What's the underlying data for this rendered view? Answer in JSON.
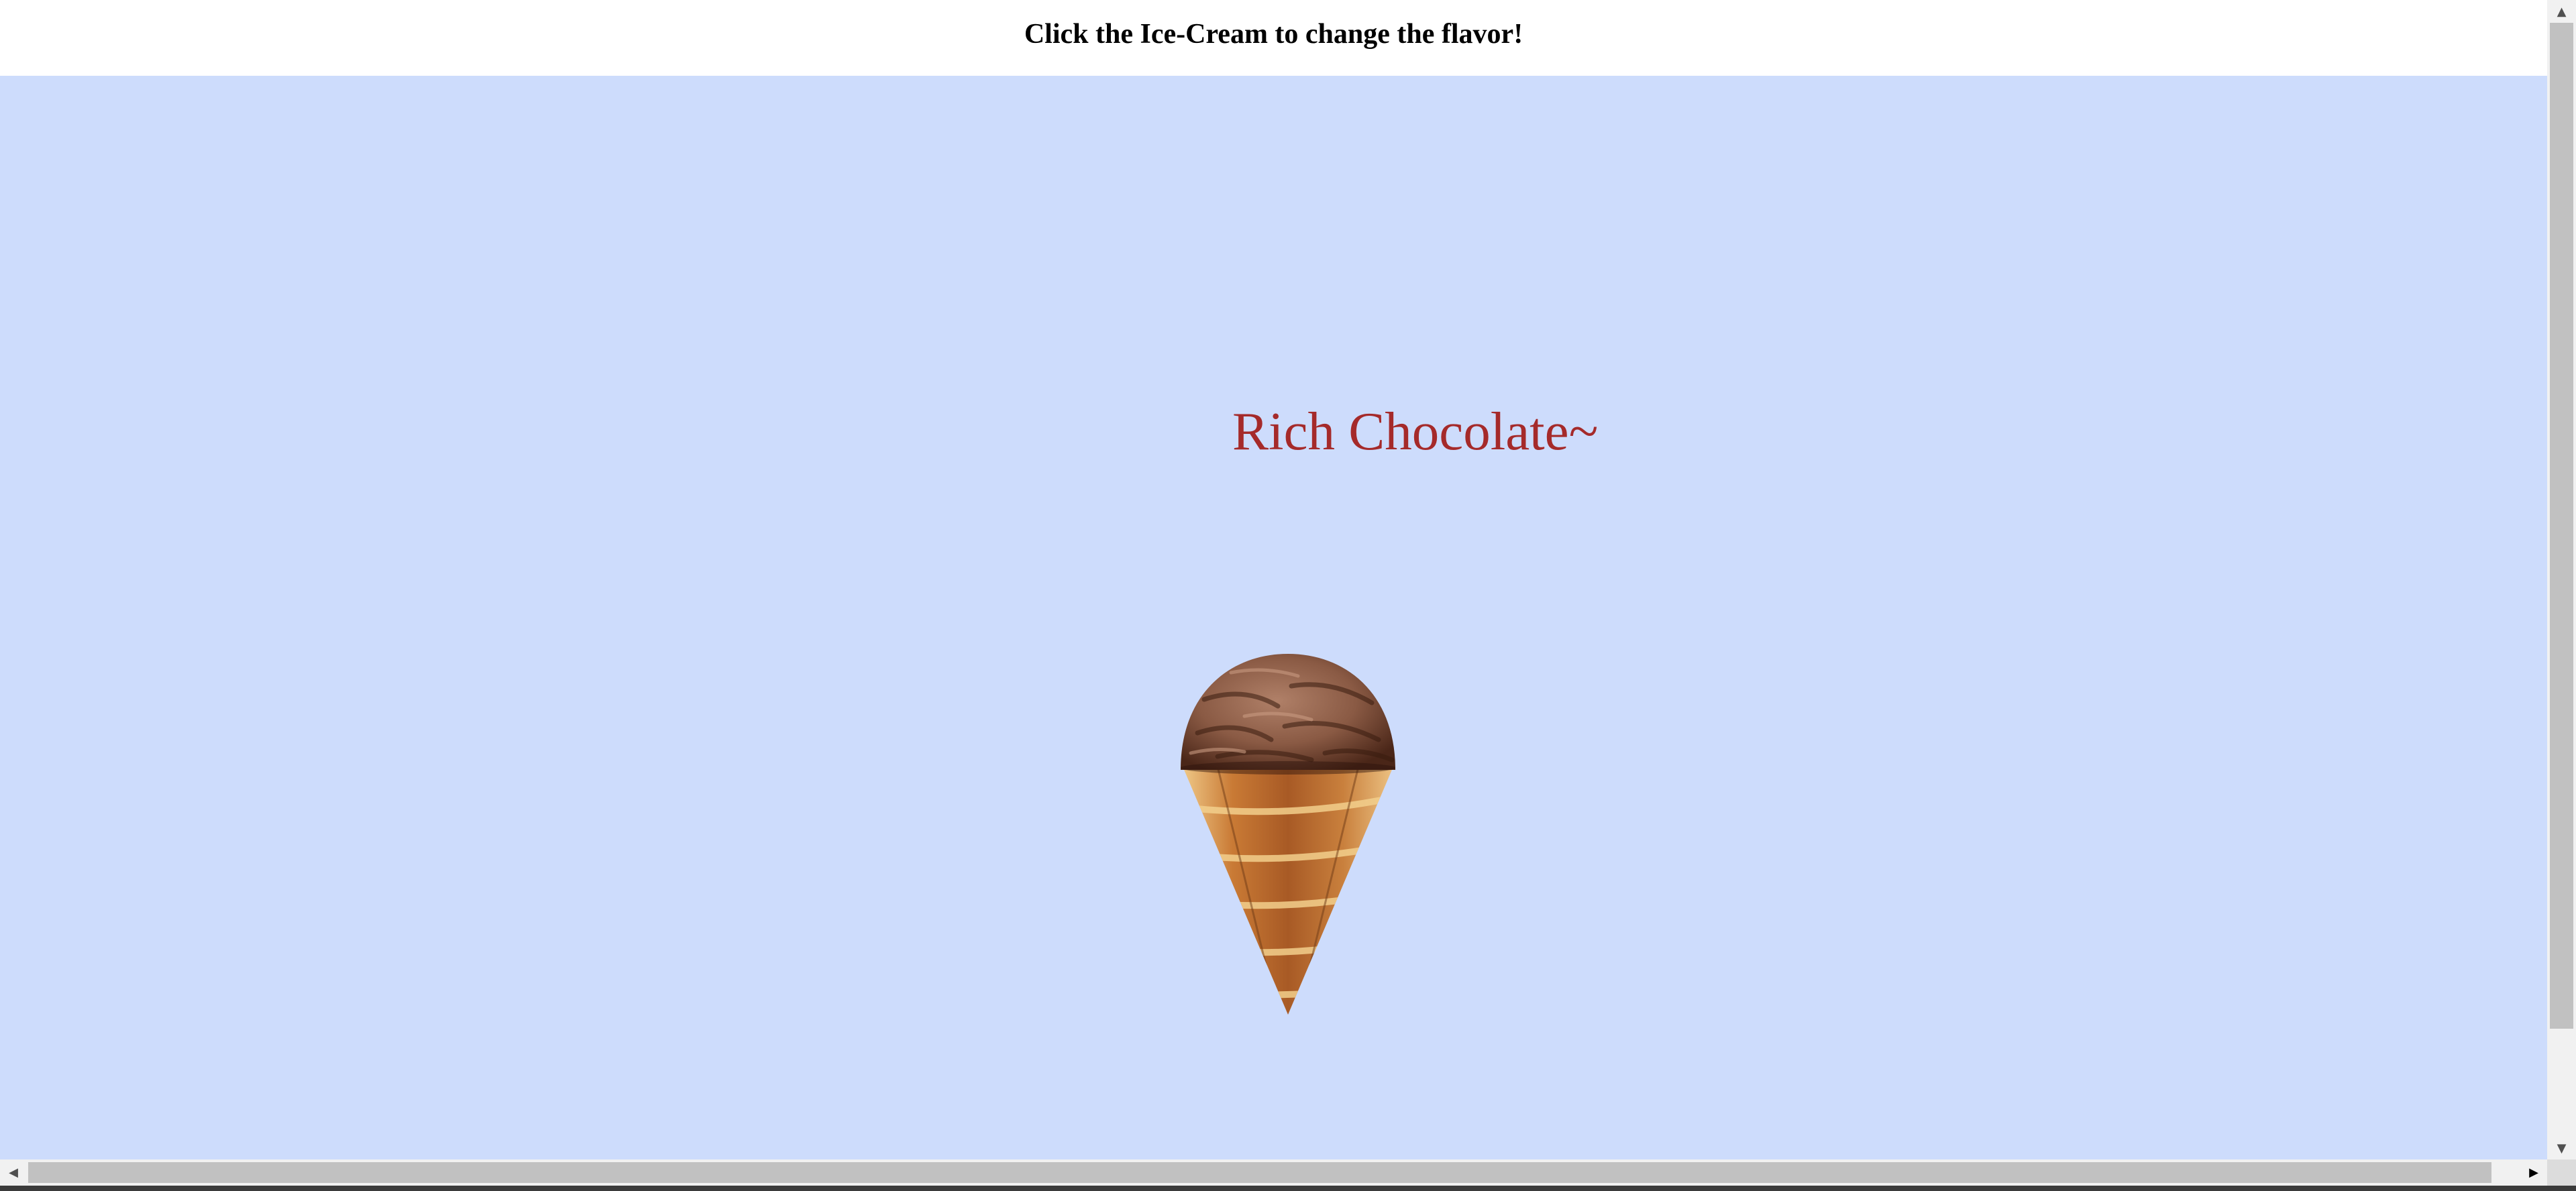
{
  "header": {
    "title": "Click the Ice-Cream to change the flavor!"
  },
  "main": {
    "flavor_label": "Rich Chocolate~",
    "ice_cream_icon": "ice-cream-cone-icon"
  },
  "colors": {
    "background": "#cddcfc",
    "flavor_text": "#a52a2a",
    "header_bg": "#ffffff"
  },
  "scrollbars": {
    "up_arrow": "▲",
    "down_arrow": "▼",
    "left_arrow": "◀",
    "right_arrow": "▶"
  }
}
